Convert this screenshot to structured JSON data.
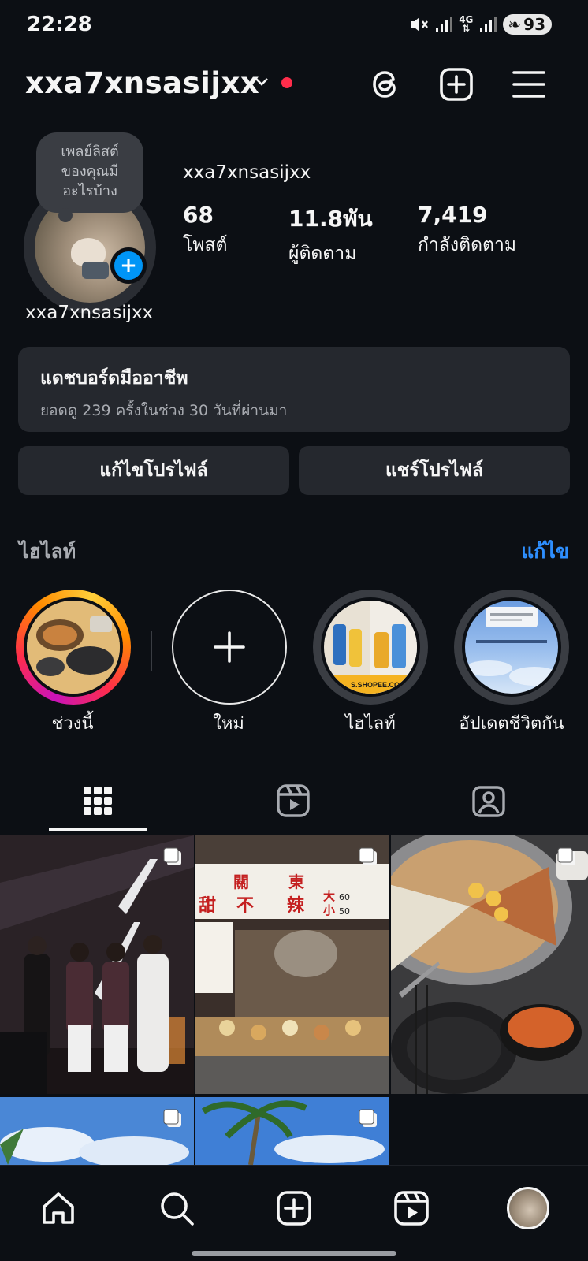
{
  "status_bar": {
    "time": "22:28",
    "network": "4G",
    "battery": "93"
  },
  "header": {
    "username": "xxa7xnsasijxx"
  },
  "profile": {
    "note": [
      "เพลย์ลิสต์",
      "ของคุณมี",
      "อะไรบ้าง"
    ],
    "name_under_avatar": "xxa7xnsasijxx",
    "display_name": "xxa7xnsasijxx",
    "stats": [
      {
        "value": "68",
        "label": "โพสต์"
      },
      {
        "value": "11.8พัน",
        "label": "ผู้ติดตาม"
      },
      {
        "value": "7,419",
        "label": "กำลังติดตาม"
      }
    ]
  },
  "dashboard": {
    "title": "แดชบอร์ดมืออาชีพ",
    "subtitle": "ยอดดู 239 ครั้งในช่วง 30 วันที่ผ่านมา"
  },
  "buttons": {
    "edit_profile": "แก้ไขโปรไฟล์",
    "share_profile": "แชร์โปรไฟล์"
  },
  "highlights": {
    "title": "ไฮไลท์",
    "edit": "แก้ไข",
    "items": [
      {
        "label": "ช่วงนี้"
      },
      {
        "label": "ใหม่"
      },
      {
        "label": "ไฮไลท์"
      },
      {
        "label": "อัปเดตชีวิตกัน"
      }
    ]
  },
  "tabs": [
    {
      "icon": "grid-icon"
    },
    {
      "icon": "reels-icon"
    },
    {
      "icon": "tagged-icon"
    }
  ],
  "posts": [
    {
      "icon": "multi-photo-icon"
    },
    {
      "icon": "multi-photo-icon"
    },
    {
      "icon": "multi-photo-icon"
    },
    {
      "icon": "multi-photo-icon"
    },
    {
      "icon": "multi-photo-icon"
    }
  ],
  "post_text": {
    "stall_sign": [
      "關",
      "東",
      "甜",
      "不",
      "辣"
    ],
    "stall_price": [
      "大",
      "小",
      "60",
      "50"
    ],
    "ad_url": "S.SHOPEE.CO.TH"
  },
  "colors": {
    "accent": "#0095f6",
    "link": "#2e8fff",
    "notification": "#ff2d4b",
    "background": "#0c0f14",
    "card": "#25282e"
  }
}
